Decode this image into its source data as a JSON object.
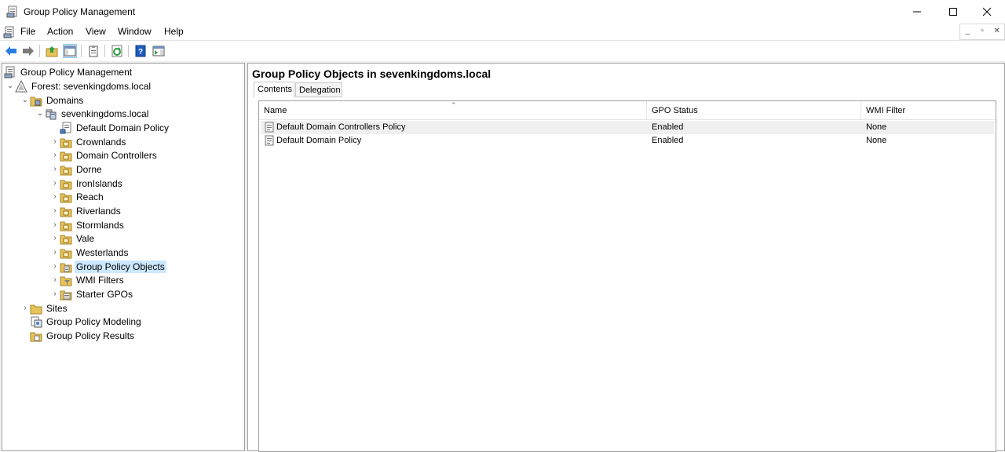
{
  "window": {
    "title": "Group Policy Management"
  },
  "menu": [
    "File",
    "Action",
    "View",
    "Window",
    "Help"
  ],
  "tree": [
    {
      "label": "Group Policy Management",
      "icon": "gpm-console-icon",
      "chev": ""
    },
    {
      "label": "Forest: sevenkingdoms.local",
      "icon": "forest-icon",
      "chev": "⌄"
    },
    {
      "label": "Domains",
      "icon": "domains-folder-icon",
      "chev": "⌄"
    },
    {
      "label": "sevenkingdoms.local",
      "icon": "domain-icon",
      "chev": "⌄"
    },
    {
      "label": "Default Domain Policy",
      "icon": "gpo-link-icon",
      "chev": ""
    },
    {
      "label": "Crownlands",
      "icon": "ou-icon",
      "chev": "›"
    },
    {
      "label": "Domain Controllers",
      "icon": "ou-icon",
      "chev": "›"
    },
    {
      "label": "Dorne",
      "icon": "ou-icon",
      "chev": "›"
    },
    {
      "label": "IronIslands",
      "icon": "ou-icon",
      "chev": "›"
    },
    {
      "label": "Reach",
      "icon": "ou-icon",
      "chev": "›"
    },
    {
      "label": "Riverlands",
      "icon": "ou-icon",
      "chev": "›"
    },
    {
      "label": "Stormlands",
      "icon": "ou-icon",
      "chev": "›"
    },
    {
      "label": "Vale",
      "icon": "ou-icon",
      "chev": "›"
    },
    {
      "label": "Westerlands",
      "icon": "ou-icon",
      "chev": "›"
    },
    {
      "label": "Group Policy Objects",
      "icon": "gpo-container-icon",
      "chev": "›"
    },
    {
      "label": "WMI Filters",
      "icon": "wmi-filters-icon",
      "chev": "›"
    },
    {
      "label": "Starter GPOs",
      "icon": "starter-gpos-icon",
      "chev": "›"
    },
    {
      "label": "Sites",
      "icon": "sites-folder-icon",
      "chev": "›"
    },
    {
      "label": "Group Policy Modeling",
      "icon": "modeling-icon",
      "chev": ""
    },
    {
      "label": "Group Policy Results",
      "icon": "results-icon",
      "chev": ""
    }
  ],
  "details": {
    "heading": "Group Policy Objects in sevenkingdoms.local",
    "tabs": [
      "Contents",
      "Delegation"
    ],
    "columns": [
      "Name",
      "GPO Status",
      "WMI Filter"
    ],
    "rows": [
      {
        "name": "Default Domain Controllers Policy",
        "status": "Enabled",
        "wmi": "None"
      },
      {
        "name": "Default Domain Policy",
        "status": "Enabled",
        "wmi": "None"
      }
    ]
  },
  "colors": {
    "selection": "#cce8ff",
    "toolbar_pressed": "#cce4f7",
    "accent_blue": "#1e6fd9",
    "folder_yellow": "#e8c35a"
  }
}
